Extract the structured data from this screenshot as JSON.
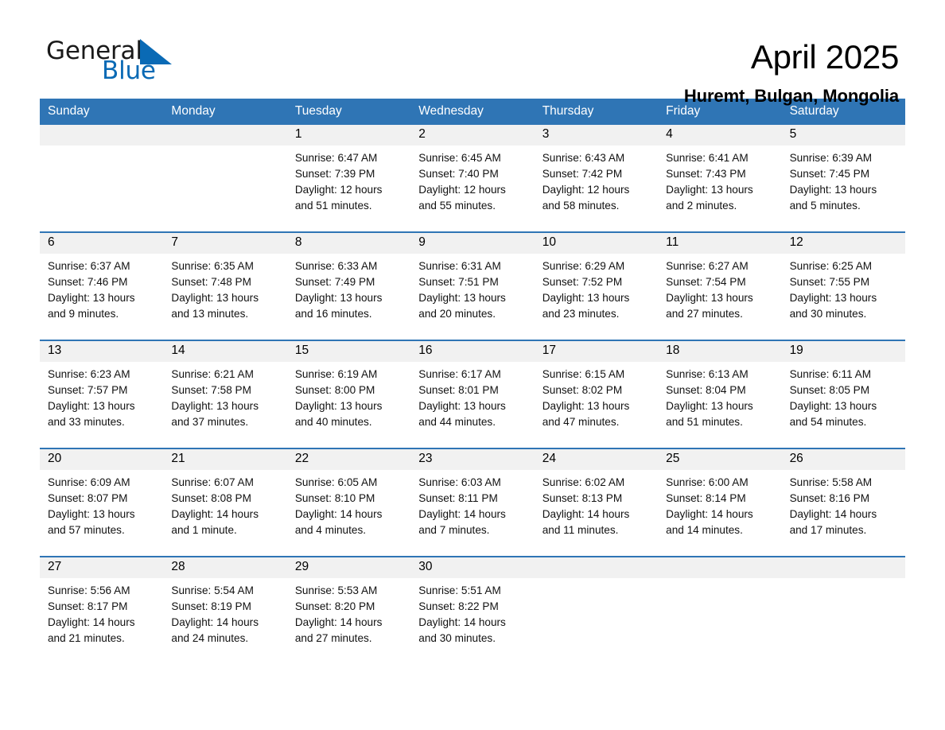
{
  "logo": {
    "word_one": "General",
    "word_two": "Blue",
    "triangle_icon": "triangle-icon",
    "accent_color": "#0a6ab5"
  },
  "header": {
    "month_title": "April 2025",
    "location": "Huremt, Bulgan, Mongolia"
  },
  "theme": {
    "header_blue": "#2f75b5",
    "day_band_gray": "#f1f1f1",
    "text_black": "#000000"
  },
  "calendar": {
    "weekdays": [
      "Sunday",
      "Monday",
      "Tuesday",
      "Wednesday",
      "Thursday",
      "Friday",
      "Saturday"
    ],
    "weeks": [
      [
        {
          "day": "",
          "empty": true
        },
        {
          "day": "",
          "empty": true
        },
        {
          "day": "1",
          "sunrise": "Sunrise: 6:47 AM",
          "sunset": "Sunset: 7:39 PM",
          "daylight_line1": "Daylight: 12 hours",
          "daylight_line2": "and 51 minutes."
        },
        {
          "day": "2",
          "sunrise": "Sunrise: 6:45 AM",
          "sunset": "Sunset: 7:40 PM",
          "daylight_line1": "Daylight: 12 hours",
          "daylight_line2": "and 55 minutes."
        },
        {
          "day": "3",
          "sunrise": "Sunrise: 6:43 AM",
          "sunset": "Sunset: 7:42 PM",
          "daylight_line1": "Daylight: 12 hours",
          "daylight_line2": "and 58 minutes."
        },
        {
          "day": "4",
          "sunrise": "Sunrise: 6:41 AM",
          "sunset": "Sunset: 7:43 PM",
          "daylight_line1": "Daylight: 13 hours",
          "daylight_line2": "and 2 minutes."
        },
        {
          "day": "5",
          "sunrise": "Sunrise: 6:39 AM",
          "sunset": "Sunset: 7:45 PM",
          "daylight_line1": "Daylight: 13 hours",
          "daylight_line2": "and 5 minutes."
        }
      ],
      [
        {
          "day": "6",
          "sunrise": "Sunrise: 6:37 AM",
          "sunset": "Sunset: 7:46 PM",
          "daylight_line1": "Daylight: 13 hours",
          "daylight_line2": "and 9 minutes."
        },
        {
          "day": "7",
          "sunrise": "Sunrise: 6:35 AM",
          "sunset": "Sunset: 7:48 PM",
          "daylight_line1": "Daylight: 13 hours",
          "daylight_line2": "and 13 minutes."
        },
        {
          "day": "8",
          "sunrise": "Sunrise: 6:33 AM",
          "sunset": "Sunset: 7:49 PM",
          "daylight_line1": "Daylight: 13 hours",
          "daylight_line2": "and 16 minutes."
        },
        {
          "day": "9",
          "sunrise": "Sunrise: 6:31 AM",
          "sunset": "Sunset: 7:51 PM",
          "daylight_line1": "Daylight: 13 hours",
          "daylight_line2": "and 20 minutes."
        },
        {
          "day": "10",
          "sunrise": "Sunrise: 6:29 AM",
          "sunset": "Sunset: 7:52 PM",
          "daylight_line1": "Daylight: 13 hours",
          "daylight_line2": "and 23 minutes."
        },
        {
          "day": "11",
          "sunrise": "Sunrise: 6:27 AM",
          "sunset": "Sunset: 7:54 PM",
          "daylight_line1": "Daylight: 13 hours",
          "daylight_line2": "and 27 minutes."
        },
        {
          "day": "12",
          "sunrise": "Sunrise: 6:25 AM",
          "sunset": "Sunset: 7:55 PM",
          "daylight_line1": "Daylight: 13 hours",
          "daylight_line2": "and 30 minutes."
        }
      ],
      [
        {
          "day": "13",
          "sunrise": "Sunrise: 6:23 AM",
          "sunset": "Sunset: 7:57 PM",
          "daylight_line1": "Daylight: 13 hours",
          "daylight_line2": "and 33 minutes."
        },
        {
          "day": "14",
          "sunrise": "Sunrise: 6:21 AM",
          "sunset": "Sunset: 7:58 PM",
          "daylight_line1": "Daylight: 13 hours",
          "daylight_line2": "and 37 minutes."
        },
        {
          "day": "15",
          "sunrise": "Sunrise: 6:19 AM",
          "sunset": "Sunset: 8:00 PM",
          "daylight_line1": "Daylight: 13 hours",
          "daylight_line2": "and 40 minutes."
        },
        {
          "day": "16",
          "sunrise": "Sunrise: 6:17 AM",
          "sunset": "Sunset: 8:01 PM",
          "daylight_line1": "Daylight: 13 hours",
          "daylight_line2": "and 44 minutes."
        },
        {
          "day": "17",
          "sunrise": "Sunrise: 6:15 AM",
          "sunset": "Sunset: 8:02 PM",
          "daylight_line1": "Daylight: 13 hours",
          "daylight_line2": "and 47 minutes."
        },
        {
          "day": "18",
          "sunrise": "Sunrise: 6:13 AM",
          "sunset": "Sunset: 8:04 PM",
          "daylight_line1": "Daylight: 13 hours",
          "daylight_line2": "and 51 minutes."
        },
        {
          "day": "19",
          "sunrise": "Sunrise: 6:11 AM",
          "sunset": "Sunset: 8:05 PM",
          "daylight_line1": "Daylight: 13 hours",
          "daylight_line2": "and 54 minutes."
        }
      ],
      [
        {
          "day": "20",
          "sunrise": "Sunrise: 6:09 AM",
          "sunset": "Sunset: 8:07 PM",
          "daylight_line1": "Daylight: 13 hours",
          "daylight_line2": "and 57 minutes."
        },
        {
          "day": "21",
          "sunrise": "Sunrise: 6:07 AM",
          "sunset": "Sunset: 8:08 PM",
          "daylight_line1": "Daylight: 14 hours",
          "daylight_line2": "and 1 minute."
        },
        {
          "day": "22",
          "sunrise": "Sunrise: 6:05 AM",
          "sunset": "Sunset: 8:10 PM",
          "daylight_line1": "Daylight: 14 hours",
          "daylight_line2": "and 4 minutes."
        },
        {
          "day": "23",
          "sunrise": "Sunrise: 6:03 AM",
          "sunset": "Sunset: 8:11 PM",
          "daylight_line1": "Daylight: 14 hours",
          "daylight_line2": "and 7 minutes."
        },
        {
          "day": "24",
          "sunrise": "Sunrise: 6:02 AM",
          "sunset": "Sunset: 8:13 PM",
          "daylight_line1": "Daylight: 14 hours",
          "daylight_line2": "and 11 minutes."
        },
        {
          "day": "25",
          "sunrise": "Sunrise: 6:00 AM",
          "sunset": "Sunset: 8:14 PM",
          "daylight_line1": "Daylight: 14 hours",
          "daylight_line2": "and 14 minutes."
        },
        {
          "day": "26",
          "sunrise": "Sunrise: 5:58 AM",
          "sunset": "Sunset: 8:16 PM",
          "daylight_line1": "Daylight: 14 hours",
          "daylight_line2": "and 17 minutes."
        }
      ],
      [
        {
          "day": "27",
          "sunrise": "Sunrise: 5:56 AM",
          "sunset": "Sunset: 8:17 PM",
          "daylight_line1": "Daylight: 14 hours",
          "daylight_line2": "and 21 minutes."
        },
        {
          "day": "28",
          "sunrise": "Sunrise: 5:54 AM",
          "sunset": "Sunset: 8:19 PM",
          "daylight_line1": "Daylight: 14 hours",
          "daylight_line2": "and 24 minutes."
        },
        {
          "day": "29",
          "sunrise": "Sunrise: 5:53 AM",
          "sunset": "Sunset: 8:20 PM",
          "daylight_line1": "Daylight: 14 hours",
          "daylight_line2": "and 27 minutes."
        },
        {
          "day": "30",
          "sunrise": "Sunrise: 5:51 AM",
          "sunset": "Sunset: 8:22 PM",
          "daylight_line1": "Daylight: 14 hours",
          "daylight_line2": "and 30 minutes."
        },
        {
          "day": "",
          "empty": true
        },
        {
          "day": "",
          "empty": true
        },
        {
          "day": "",
          "empty": true
        }
      ]
    ]
  }
}
